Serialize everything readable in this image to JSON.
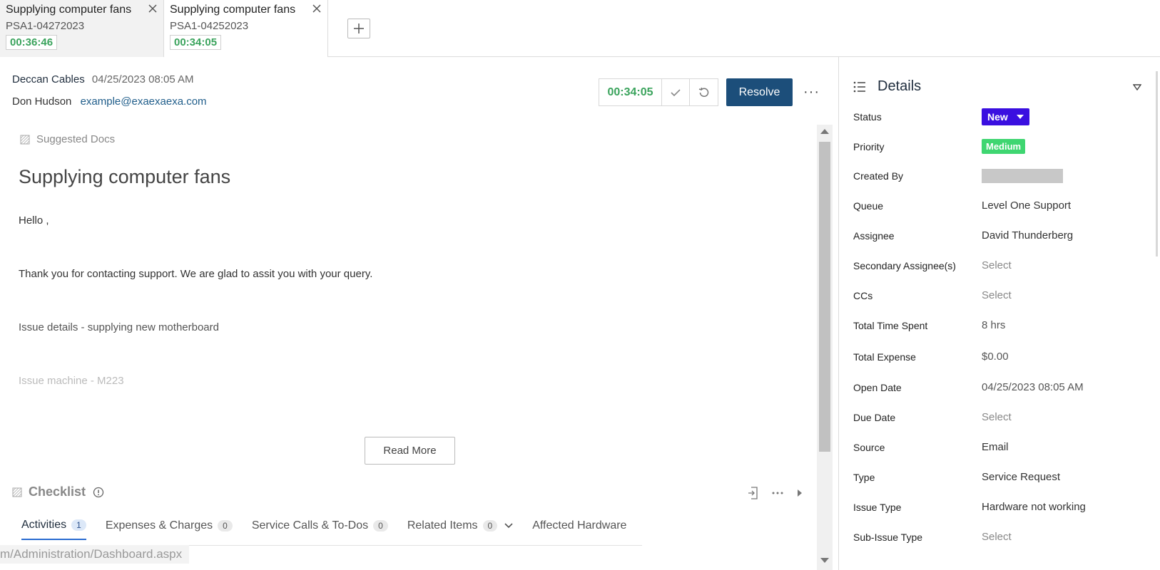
{
  "tabs": [
    {
      "title": "Supplying computer fans",
      "id": "PSA1-04272023",
      "timer": "00:36:46"
    },
    {
      "title": "Supplying computer fans",
      "id": "PSA1-04252023",
      "timer": "00:34:05"
    }
  ],
  "header": {
    "company": "Deccan Cables",
    "date": "04/25/2023 08:05 AM",
    "contact": "Don Hudson",
    "email": "example@exaexaexa.com",
    "timer": "00:34:05",
    "resolve_label": "Resolve",
    "more": "···"
  },
  "content": {
    "suggested_docs": "Suggested Docs",
    "title": "Supplying computer fans",
    "greeting": "Hello             ,",
    "line1": "Thank you for contacting support. We are glad to assit you with your query.",
    "line2": "Issue details - supplying new motherboard",
    "line3": "Issue machine - M223",
    "read_more": "Read More",
    "checklist": "Checklist"
  },
  "subtabs": [
    {
      "label": "Activities",
      "count": "1"
    },
    {
      "label": "Expenses & Charges",
      "count": "0"
    },
    {
      "label": "Service Calls & To-Dos",
      "count": "0"
    },
    {
      "label": "Related Items",
      "count": "0"
    },
    {
      "label": "Affected Hardware",
      "count": ""
    }
  ],
  "status_url": "m/Administration/Dashboard.aspx",
  "details": {
    "title": "Details",
    "status_label": "Status",
    "status_value": "New",
    "priority_label": "Priority",
    "priority_value": "Medium",
    "created_by_label": "Created By",
    "queue_label": "Queue",
    "queue_value": "Level One Support",
    "assignee_label": "Assignee",
    "assignee_value": "David Thunderberg",
    "secondary_label": "Secondary Assignee(s)",
    "secondary_value": "Select",
    "ccs_label": "CCs",
    "ccs_value": "Select",
    "time_label": "Total Time Spent",
    "time_value": "8 hrs",
    "expense_label": "Total Expense",
    "expense_value": "$0.00",
    "open_label": "Open Date",
    "open_value": "04/25/2023 08:05 AM",
    "due_label": "Due Date",
    "due_value": "Select",
    "source_label": "Source",
    "source_value": "Email",
    "type_label": "Type",
    "type_value": "Service Request",
    "issue_label": "Issue Type",
    "issue_value": "Hardware not working",
    "subissue_label": "Sub-Issue Type",
    "subissue_value": "Select"
  },
  "colors": {
    "timer_green": "#3aa35c",
    "resolve_blue": "#1c4e7a",
    "status_purple": "#3a0fe0",
    "priority_green": "#3fd671",
    "email_link": "#1f5d8a"
  }
}
